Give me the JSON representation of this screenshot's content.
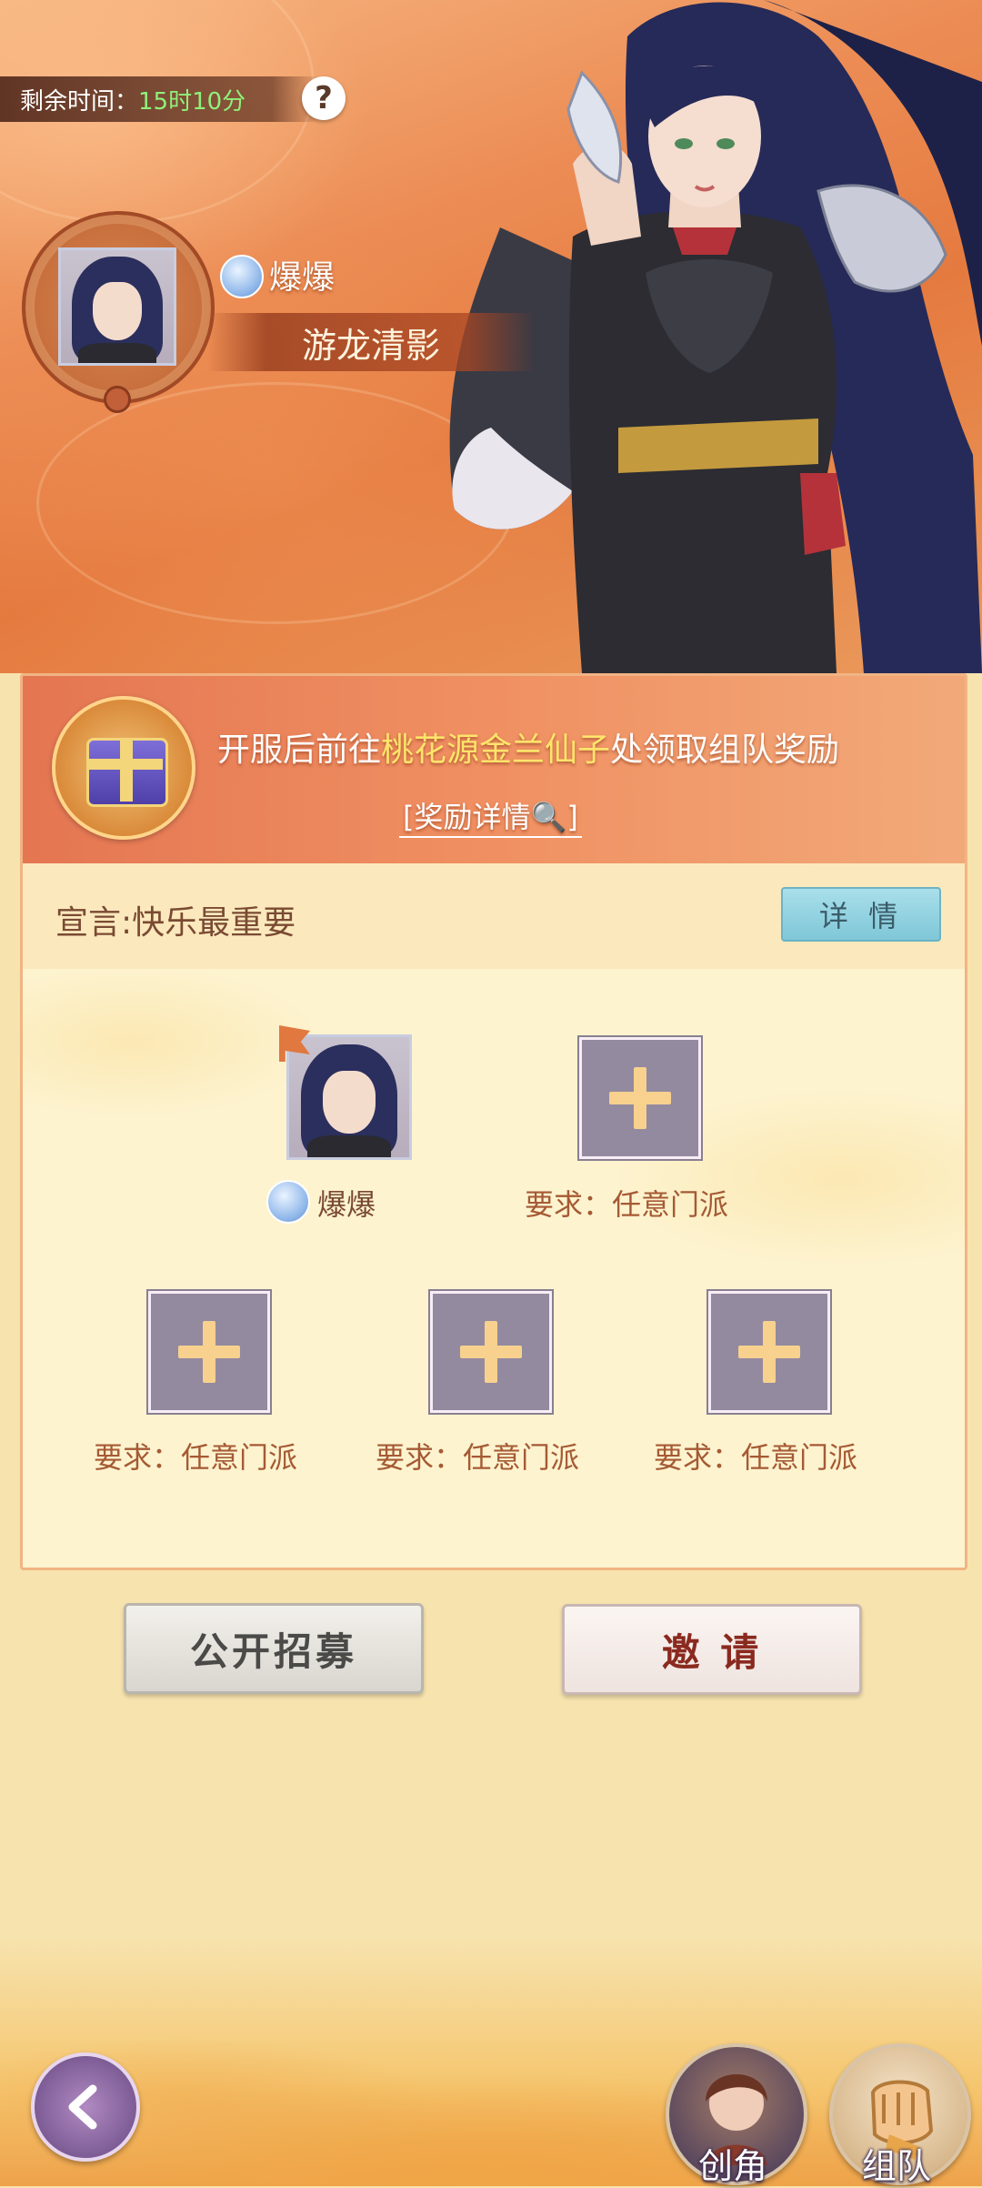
{
  "header": {
    "timer_label": "剩余时间：",
    "timer_value": "15时10分",
    "help_symbol": "?"
  },
  "leader": {
    "name": "爆爆",
    "title": "游龙清影"
  },
  "reward": {
    "text_prefix": "开服后前往",
    "text_highlight": "桃花源金兰仙子",
    "text_suffix": "处领取组队奖励",
    "detail_link": "[奖励详情🔍]"
  },
  "declaration": {
    "text": "宣言:快乐最重要",
    "detail_button": "详 情"
  },
  "members": {
    "leader_name": "爆爆",
    "slots": [
      {
        "requirement": "要求：任意门派"
      },
      {
        "requirement": "要求：任意门派"
      },
      {
        "requirement": "要求：任意门派"
      },
      {
        "requirement": "要求：任意门派"
      }
    ]
  },
  "actions": {
    "recruit_label": "公开招募",
    "invite_label": "邀 请"
  },
  "bottom_nav": {
    "create_role_label": "创角",
    "team_label": "组队"
  },
  "colors": {
    "accent_orange": "#e47652",
    "highlight_yellow": "#ffe46b",
    "timer_green": "#8ff07a",
    "detail_button_blue": "#7fc7d8"
  }
}
